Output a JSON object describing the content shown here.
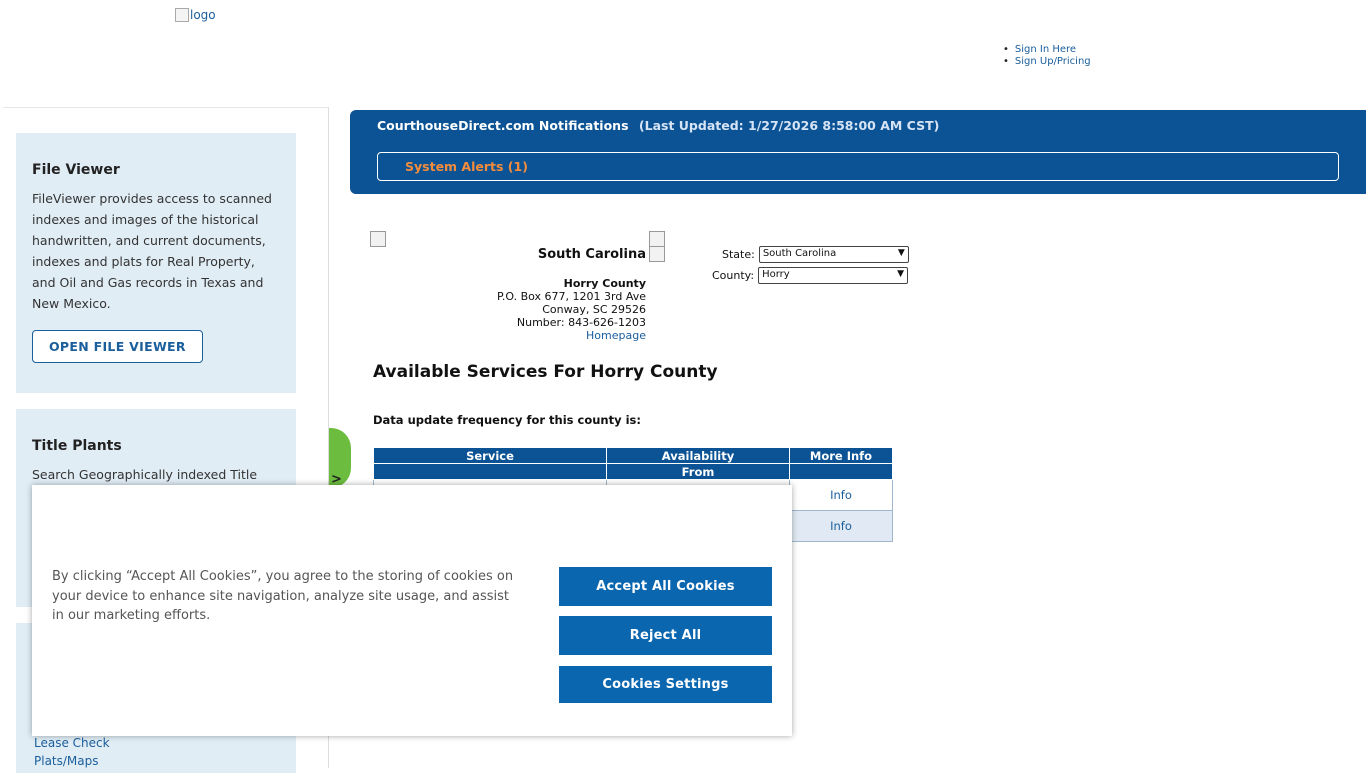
{
  "header": {
    "logo_alt": "logo",
    "nav": [
      "Sign In Here",
      "Sign Up/Pricing"
    ]
  },
  "sidebar": {
    "file_viewer": {
      "title": "File Viewer",
      "text": "FileViewer provides access to scanned indexes and images of the historical handwritten, and current documents, indexes and plats for Real Property, and Oil and Gas records in Texas and New Mexico.",
      "button": "OPEN FILE VIEWER"
    },
    "title_plants": {
      "title": "Title Plants",
      "text": "Search Geographically indexed Title"
    },
    "links": [
      "Lease Check",
      "Plats/Maps"
    ],
    "tab_glyph": ">"
  },
  "notifications": {
    "title": "CourthouseDirect.com Notifications",
    "last_updated": "(Last Updated: 1/27/2026 8:58:00 AM CST)",
    "alerts_label": "System Alerts (1)"
  },
  "county": {
    "state_name": "South Carolina",
    "county_name": "Horry County",
    "address1": "P.O. Box 677, 1201 3rd Ave",
    "address2": "Conway, SC 29526",
    "phone": "Number: 843-626-1203",
    "homepage": "Homepage",
    "state_label": "State:",
    "state_value": "South Carolina",
    "county_label": "County:",
    "county_value": "Horry"
  },
  "services": {
    "title": "Available Services For Horry County",
    "frequency": "Data update frequency for this county is:",
    "headers": [
      "Service",
      "Availability",
      "More Info"
    ],
    "subheader": "From",
    "rows": [
      {
        "service": "",
        "availability": "",
        "info": "Info"
      },
      {
        "service": "",
        "availability": "",
        "info": "Info"
      }
    ]
  },
  "cookie_banner": {
    "text": "By clicking “Accept All Cookies”, you agree to the storing of cookies on your device to enhance site navigation, analyze site usage, and assist in our marketing efforts.",
    "accept": "Accept All Cookies",
    "reject": "Reject All",
    "settings": "Cookies Settings"
  }
}
